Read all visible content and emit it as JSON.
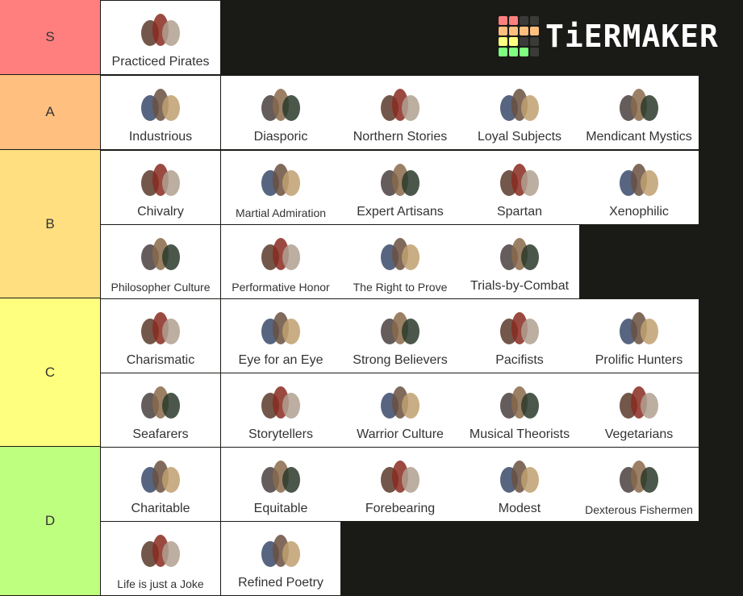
{
  "logo": {
    "text": "TiERMAKER",
    "grid_colors": [
      "#ff7f7f",
      "#ff7f7f",
      "#3a3a38",
      "#3a3a38",
      "#ffbf7f",
      "#ffbf7f",
      "#ffbf7f",
      "#ffbf7f",
      "#ffff7f",
      "#ffff7f",
      "#3a3a38",
      "#3a3a38",
      "#7fff7f",
      "#7fff7f",
      "#7fff7f",
      "#3a3a38"
    ]
  },
  "tiers": [
    {
      "label": "S",
      "color": "#ff7f7f",
      "rows": [
        [
          "Practiced Pirates"
        ]
      ],
      "icons": [
        [
          "shields-icon"
        ]
      ]
    },
    {
      "label": "A",
      "color": "#ffbf7f",
      "rows": [
        [
          "Industrious",
          "Diasporic",
          "Northern Stories",
          "Loyal Subjects",
          "Mendicant Mystics"
        ]
      ],
      "icons": [
        [
          "tools-icon",
          "traveler-icon",
          "standing-stones-icon",
          "court-icon",
          "mystic-icon"
        ]
      ]
    },
    {
      "label": "B",
      "color": "#ffdf7f",
      "rows": [
        [
          "Chivalry",
          "Martial Admiration",
          "Expert Artisans",
          "Spartan",
          "Xenophilic"
        ],
        [
          "Philosopher Culture",
          "Performative Honor",
          "The Right to Prove",
          "Trials-by-Combat"
        ]
      ],
      "icons": [
        [
          "knight-horse-icon",
          "knight-horse-icon",
          "artisan-icon",
          "throne-hall-icon",
          "two-people-icon"
        ],
        [
          "scholar-icon",
          "warrior-shield-icon",
          "warrior-shield-icon",
          "crossed-axes-icon"
        ]
      ]
    },
    {
      "label": "C",
      "color": "#ffff7f",
      "rows": [
        [
          "Charismatic",
          "Eye for an Eye",
          "Strong Believers",
          "Pacifists",
          "Prolific Hunters"
        ],
        [
          "Seafarers",
          "Storytellers",
          "Warrior Culture",
          "Musical Theorists",
          "Vegetarians"
        ]
      ],
      "icons": [
        [
          "crowd-icon",
          "judge-icon",
          "believers-icon",
          "doves-icon",
          "hunter-falcon-icon"
        ],
        [
          "ship-icon",
          "storyteller-icon",
          "warriors-icon",
          "musicians-icon",
          "vegetables-icon"
        ]
      ]
    },
    {
      "label": "D",
      "color": "#bfff7f",
      "rows": [
        [
          "Charitable",
          "Equitable",
          "Forebearing",
          "Modest",
          "Dexterous Fishermen"
        ],
        [
          "Life is just a Joke",
          "Refined Poetry"
        ]
      ],
      "icons": [
        [
          "giving-icon",
          "two-people-icon",
          "scholar-icon",
          "artisan-icon",
          "boat-icon"
        ],
        [
          "traveler-icon",
          "quill-scroll-icon"
        ]
      ]
    }
  ]
}
